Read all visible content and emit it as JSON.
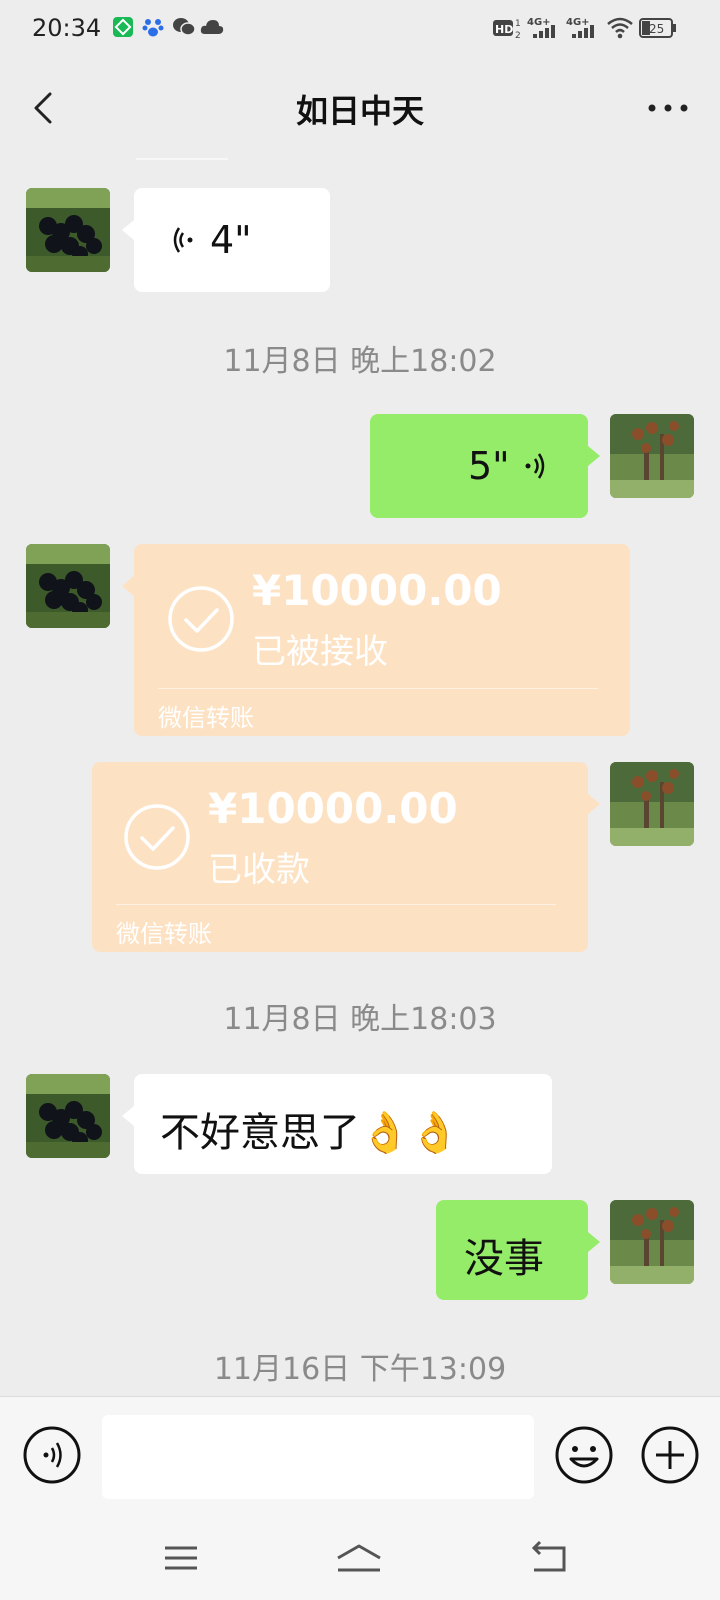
{
  "status_bar": {
    "time": "20:34",
    "icons": [
      "app-green-icon",
      "baidu-paw-icon",
      "wechat-icon",
      "cloud-icon"
    ],
    "right_icons": [
      "hd-icon",
      "signal-4g-icon",
      "signal-4g-icon",
      "wifi-icon",
      "battery-icon"
    ],
    "hd_label": "HD",
    "hd_sim": "2",
    "net_1": "4G",
    "net_2": "4G",
    "battery_level": "25"
  },
  "header": {
    "title": "如日中天",
    "back_icon": "back-chevron-icon",
    "more_icon": "more-dots-icon"
  },
  "messages": [
    {
      "type": "voice",
      "side": "left",
      "duration": "4\""
    },
    {
      "type": "timestamp",
      "text": "11月8日 晚上18:02"
    },
    {
      "type": "voice",
      "side": "right",
      "duration": "5\""
    },
    {
      "type": "transfer",
      "side": "left",
      "amount": "¥10000.00",
      "status": "已被接收",
      "label": "微信转账"
    },
    {
      "type": "transfer",
      "side": "right",
      "amount": "¥10000.00",
      "status": "已收款",
      "label": "微信转账"
    },
    {
      "type": "timestamp",
      "text": "11月8日 晚上18:03"
    },
    {
      "type": "text",
      "side": "left",
      "text": "不好意思了👌👌"
    },
    {
      "type": "text",
      "side": "right",
      "text": "没事"
    },
    {
      "type": "timestamp",
      "text": "11月16日 下午13:09"
    }
  ],
  "input_bar": {
    "voice_icon": "voice-input-icon",
    "emoji_icon": "emoji-icon",
    "plus_icon": "plus-icon",
    "value": ""
  },
  "nav_bar": {
    "icons": [
      "menu-icon",
      "home-icon",
      "back-icon"
    ]
  },
  "colors": {
    "background": "#ededed",
    "green_bubble": "#95ec69",
    "white_bubble": "#ffffff",
    "transfer_bubble": "#fde1c3",
    "timestamp_text": "#8a8a8a"
  }
}
